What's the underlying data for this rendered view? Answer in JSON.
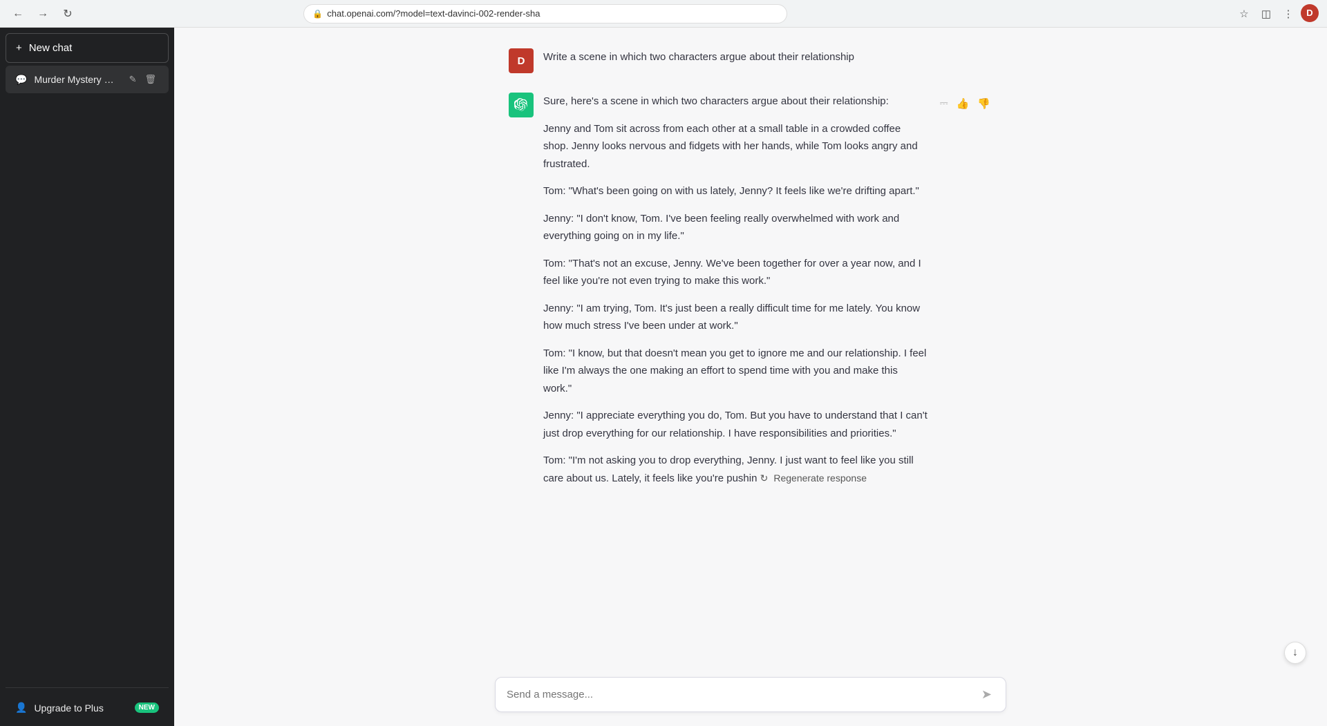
{
  "browser": {
    "url": "chat.openai.com/?model=text-davinci-002-render-sha",
    "back_label": "←",
    "forward_label": "→",
    "reload_label": "↻",
    "user_initial": "D"
  },
  "sidebar": {
    "new_chat_label": "New chat",
    "chat_items": [
      {
        "id": "murder-mystery",
        "label": "Murder Mystery Plot."
      }
    ],
    "upgrade_label": "Upgrade to Plus",
    "new_badge": "NEW"
  },
  "main": {
    "user_message": "Write a scene in which two characters argue about their relationship",
    "user_initial": "D",
    "assistant_paragraphs": [
      "Sure, here's a scene in which two characters argue about their relationship:",
      "Jenny and Tom sit across from each other at a small table in a crowded coffee shop. Jenny looks nervous and fidgets with her hands, while Tom looks angry and frustrated.",
      "Tom: \"What's been going on with us lately, Jenny? It feels like we're drifting apart.\"",
      "Jenny: \"I don't know, Tom. I've been feeling really overwhelmed with work and everything going on in my life.\"",
      "Tom: \"That's not an excuse, Jenny. We've been together for over a year now, and I feel like you're not even trying to make this work.\"",
      "Jenny: \"I am trying, Tom. It's just been a really difficult time for me lately. You know how much stress I've been under at work.\"",
      "Tom: \"I know, but that doesn't mean you get to ignore me and our relationship. I feel like I'm always the one making an effort to spend time with you and make this work.\"",
      "Jenny: \"I appreciate everything you do, Tom. But you have to understand that I can't just drop everything for our relationship. I have responsibilities and priorities.\"",
      "Tom: \"I'm not asking you to drop everything, Jenny. I just want to feel like you still care about us. Lately, it feels like you're pushin"
    ],
    "regenerate_label": "Regenerate response",
    "input_placeholder": "Send a message...",
    "copy_icon": "⎘",
    "thumbup_icon": "👍",
    "thumbdown_icon": "👎",
    "regen_icon": "↻",
    "send_icon": "➤",
    "scroll_down_icon": "↓",
    "pencil_icon": "✏",
    "trash_icon": "🗑"
  }
}
